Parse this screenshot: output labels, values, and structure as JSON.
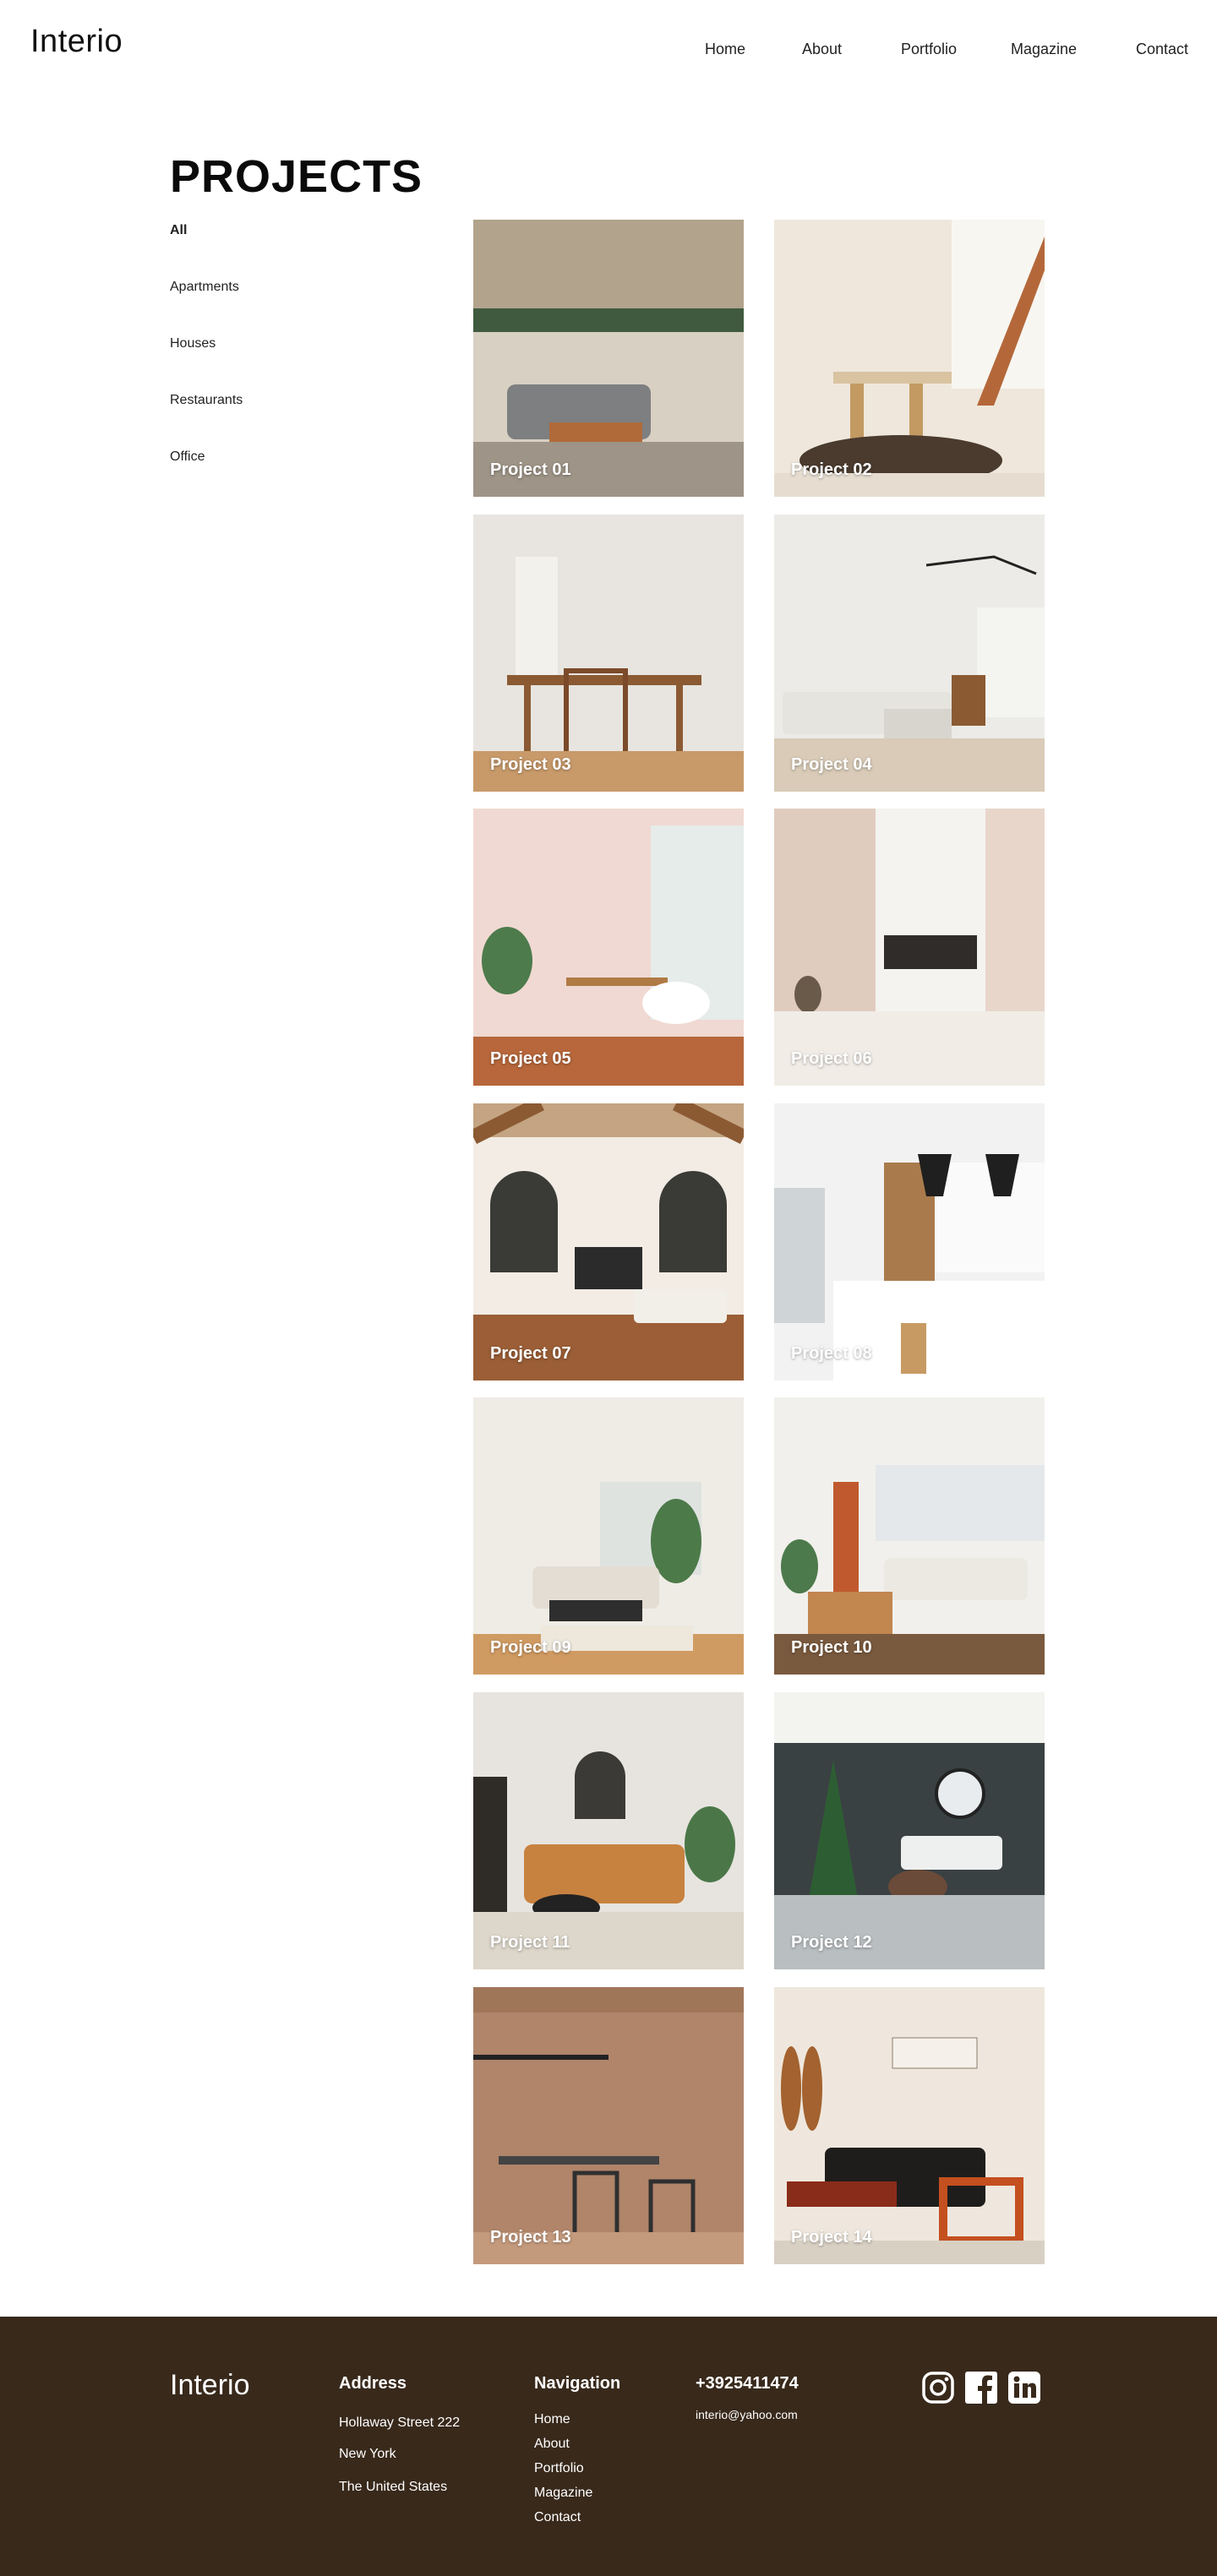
{
  "header": {
    "logo": "Interio",
    "nav": [
      "Home",
      "About",
      "Portfolio",
      "Magazine",
      "Contact"
    ]
  },
  "page_title": "PROJECTS",
  "filters": {
    "items": [
      "All",
      "Apartments",
      "Houses",
      "Restaurants",
      "Office"
    ],
    "active": "All"
  },
  "projects": [
    "Project 01",
    "Project 02",
    "Project 03",
    "Project 04",
    "Project 05",
    "Project 06",
    "Project 07",
    "Project 08",
    "Project 09",
    "Project 10",
    "Project 11",
    "Project 12",
    "Project 13",
    "Project 14"
  ],
  "footer": {
    "logo": "Interio",
    "address_heading": "Address",
    "address_lines": [
      "Hollaway Street 222",
      "New York",
      "The United States"
    ],
    "navigation_heading": "Navigation",
    "navigation_items": [
      "Home",
      "About",
      "Portfolio",
      "Magazine",
      "Contact"
    ],
    "phone": "+3925411474",
    "email": "interio@yahoo.com",
    "social_icons": [
      "instagram-icon",
      "facebook-icon",
      "linkedin-icon"
    ]
  },
  "colors": {
    "footer_bg": "#38291b",
    "text": "#111111",
    "tile_label": "#ffffff"
  }
}
